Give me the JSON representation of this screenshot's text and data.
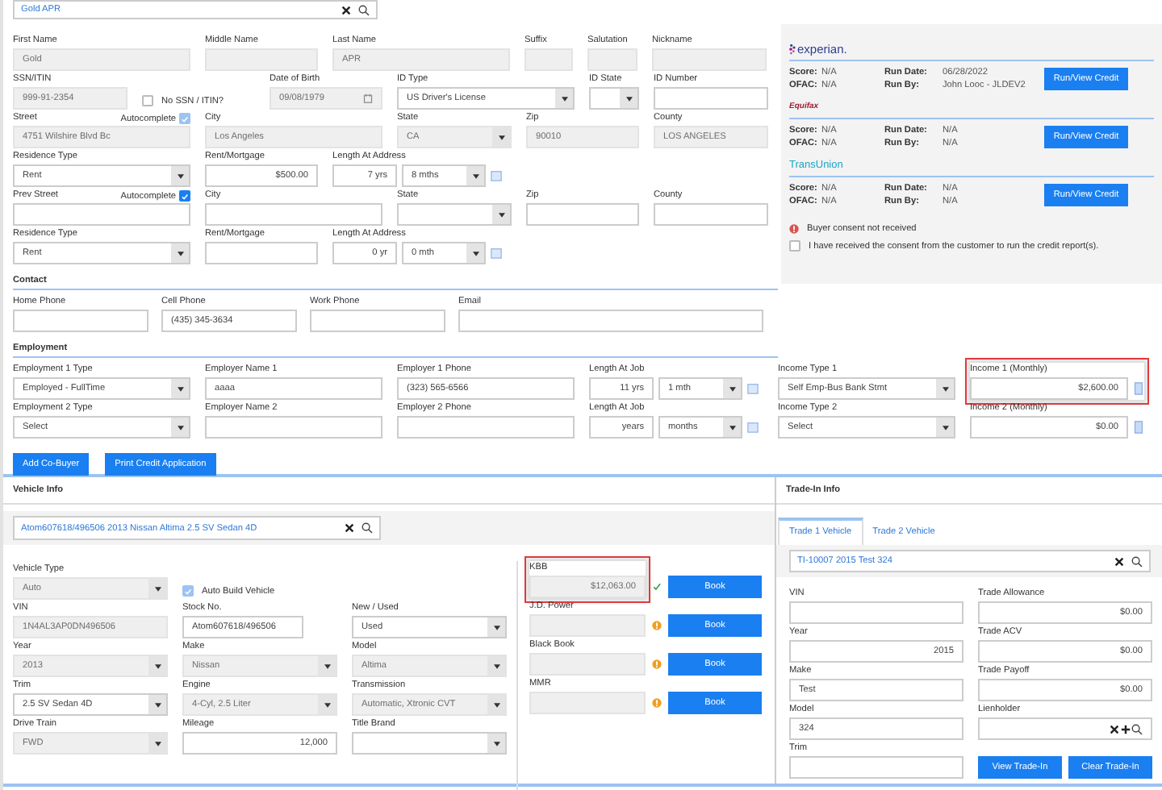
{
  "applicant_search": {
    "value": "Gold APR"
  },
  "applicant_rows": [
    [
      {
        "label": "First Name",
        "kind": "text",
        "value": "Gold",
        "disabled": true
      },
      {
        "label": "Middle Name",
        "kind": "text",
        "disabled": true
      },
      {
        "label": "Last Name",
        "kind": "text",
        "value": "APR",
        "disabled": true
      },
      {
        "label": "Suffix",
        "kind": "text",
        "disabled": true
      },
      {
        "label": "Salutation",
        "kind": "text",
        "disabled": true
      },
      {
        "label": "Nickname",
        "kind": "text",
        "disabled": true
      }
    ],
    [
      {
        "label": "SSN/ITIN",
        "kind": "text",
        "value": "999-91-2354",
        "disabled": true
      },
      {
        "label": "No SSN / ITIN?",
        "kind": "check",
        "checked": false
      },
      {
        "label": "Date of Birth",
        "kind": "date",
        "value": "09/08/1979",
        "disabled": true
      },
      {
        "label": "ID Type",
        "kind": "select",
        "value": "US Driver's License"
      },
      {
        "label": "ID State",
        "kind": "select"
      },
      {
        "label": "ID Number",
        "kind": "text"
      }
    ],
    [
      {
        "label": "Street",
        "kind": "text",
        "value": "4751 Wilshire Blvd Bc",
        "disabled": true,
        "autocomplete": {
          "label": "Autocomplete",
          "checked": true,
          "disabled": true
        }
      },
      {
        "label": "City",
        "kind": "text",
        "value": "Los Angeles",
        "disabled": true
      },
      {
        "label": "State",
        "kind": "select",
        "value": "CA",
        "disabled": true
      },
      {
        "label": "Zip",
        "kind": "text",
        "value": "90010",
        "disabled": true
      },
      {
        "label": "County",
        "kind": "text",
        "value": "LOS ANGELES",
        "disabled": true
      }
    ],
    [
      {
        "label": "Residence Type",
        "kind": "select",
        "value": "Rent"
      },
      {
        "label": "Rent/Mortgage",
        "kind": "number",
        "value": "$500.00"
      },
      {
        "label": "Length At Address",
        "kind": "length",
        "years": "7 yrs",
        "months": "8 mths"
      }
    ],
    [
      {
        "label": "Prev Street",
        "kind": "text",
        "autocomplete": {
          "label": "Autocomplete",
          "checked": true,
          "disabled": false
        }
      },
      {
        "label": "City",
        "kind": "text"
      },
      {
        "label": "State",
        "kind": "select"
      },
      {
        "label": "Zip",
        "kind": "text"
      },
      {
        "label": "County",
        "kind": "text"
      }
    ],
    [
      {
        "label": "Residence Type",
        "kind": "select",
        "value": "Rent"
      },
      {
        "label": "Rent/Mortgage",
        "kind": "number"
      },
      {
        "label": "Length At Address",
        "kind": "length",
        "years": "0 yr",
        "months": "0 mth"
      }
    ]
  ],
  "contact": {
    "title": "Contact",
    "fields": [
      {
        "label": "Home Phone",
        "kind": "text"
      },
      {
        "label": "Cell Phone",
        "kind": "text",
        "value": "(435) 345-3634"
      },
      {
        "label": "Work Phone",
        "kind": "text"
      },
      {
        "label": "Email",
        "kind": "text"
      }
    ]
  },
  "employment": {
    "title": "Employment",
    "rows": [
      [
        {
          "label": "Employment 1 Type",
          "kind": "select",
          "value": "Employed - FullTime"
        },
        {
          "label": "Employer Name 1",
          "kind": "text",
          "value": "aaaa"
        },
        {
          "label": "Employer 1 Phone",
          "kind": "text",
          "value": "(323) 565-6566"
        },
        {
          "label": "Length At Job",
          "kind": "length",
          "years": "11 yrs",
          "months": "1 mth"
        },
        {
          "label": "Income Type 1",
          "kind": "select",
          "value": "Self Emp-Bus Bank Stmt"
        },
        {
          "label": "Income 1 (Monthly)",
          "kind": "income",
          "value": "$2,600.00",
          "highlighted": true
        }
      ],
      [
        {
          "label": "Employment 2 Type",
          "kind": "select",
          "value": "Select"
        },
        {
          "label": "Employer Name 2",
          "kind": "text"
        },
        {
          "label": "Employer 2 Phone",
          "kind": "text"
        },
        {
          "label": "Length At Job",
          "kind": "length",
          "years": "years",
          "months": "months"
        },
        {
          "label": "Income Type 2",
          "kind": "select",
          "value": "Select"
        },
        {
          "label": "Income 2 (Monthly)",
          "kind": "income",
          "value": "$0.00"
        }
      ]
    ],
    "buttons": [
      "Add Co-Buyer",
      "Print Credit Application"
    ]
  },
  "credit": {
    "bureaus": [
      {
        "name": "experian.",
        "kind": "experian",
        "fields": [
          {
            "label": "Score:",
            "value": "N/A"
          },
          {
            "label": "Run Date:",
            "value": "06/28/2022"
          },
          {
            "label": "OFAC:",
            "value": "N/A"
          },
          {
            "label": "Run By:",
            "value": "John Looc - JLDEV2"
          }
        ],
        "button": "Run/View Credit"
      },
      {
        "name": "Equifax",
        "kind": "equifax",
        "fields": [
          {
            "label": "Score:",
            "value": "N/A"
          },
          {
            "label": "Run Date:",
            "value": "N/A"
          },
          {
            "label": "OFAC:",
            "value": "N/A"
          },
          {
            "label": "Run By:",
            "value": "N/A"
          }
        ],
        "button": "Run/View Credit"
      },
      {
        "name": "TransUnion",
        "kind": "transunion",
        "fields": [
          {
            "label": "Score:",
            "value": "N/A"
          },
          {
            "label": "Run Date:",
            "value": "N/A"
          },
          {
            "label": "OFAC:",
            "value": "N/A"
          },
          {
            "label": "Run By:",
            "value": "N/A"
          }
        ],
        "button": "Run/View Credit"
      }
    ],
    "warning": "Buyer consent not received",
    "consent": {
      "label": "I have received the consent from the customer to run the credit report(s).",
      "checked": false
    }
  },
  "vehicle_info": {
    "title": "Vehicle Info",
    "search": {
      "value": "Atom607618/496506 2013 Nissan Altima 2.5 SV Sedan 4D"
    },
    "rows": [
      [
        {
          "label": "Vehicle Type",
          "kind": "select",
          "value": "Auto",
          "disabled": true
        },
        {
          "label": "Auto Build Vehicle",
          "kind": "check",
          "checked": true,
          "disabled": true
        }
      ],
      [
        {
          "label": "VIN",
          "kind": "text",
          "value": "1N4AL3AP0DN496506",
          "disabled": true
        },
        {
          "label": "Stock No.",
          "kind": "text",
          "value": "Atom607618/496506"
        },
        {
          "label": "New / Used",
          "kind": "select",
          "value": "Used"
        }
      ],
      [
        {
          "label": "Year",
          "kind": "select",
          "value": "2013",
          "disabled": true
        },
        {
          "label": "Make",
          "kind": "select",
          "value": "Nissan",
          "disabled": true
        },
        {
          "label": "Model",
          "kind": "select",
          "value": "Altima",
          "disabled": true
        }
      ],
      [
        {
          "label": "Trim",
          "kind": "select",
          "value": "2.5 SV Sedan 4D"
        },
        {
          "label": "Engine",
          "kind": "select",
          "value": "4-Cyl, 2.5 Liter",
          "disabled": true
        },
        {
          "label": "Transmission",
          "kind": "select",
          "value": "Automatic, Xtronic CVT",
          "disabled": true
        }
      ],
      [
        {
          "label": "Drive Train",
          "kind": "select",
          "value": "FWD",
          "disabled": true
        },
        {
          "label": "Mileage",
          "kind": "number",
          "value": "12,000"
        },
        {
          "label": "Title Brand",
          "kind": "select"
        }
      ]
    ],
    "book_values": [
      {
        "label": "KBB",
        "value": "$12,063.00",
        "complete": true,
        "highlighted": true,
        "button": "Book"
      },
      {
        "label": "J.D. Power",
        "complete": false,
        "button": "Book"
      },
      {
        "label": "Black Book",
        "complete": false,
        "button": "Book"
      },
      {
        "label": "MMR",
        "complete": false,
        "button": "Book"
      }
    ]
  },
  "trade_in": {
    "title": "Trade-In Info",
    "tabs": [
      {
        "label": "Trade 1 Vehicle",
        "selected": true
      },
      {
        "label": "Trade 2 Vehicle",
        "selected": false
      }
    ],
    "search": {
      "value": "TI-10007 2015 Test 324"
    },
    "left": [
      {
        "label": "VIN",
        "kind": "text"
      },
      {
        "label": "Year",
        "kind": "number",
        "value": "2015"
      },
      {
        "label": "Make",
        "kind": "text",
        "value": "Test"
      },
      {
        "label": "Model",
        "kind": "text",
        "value": "324"
      },
      {
        "label": "Trim",
        "kind": "text"
      }
    ],
    "right": [
      {
        "label": "Trade Allowance",
        "kind": "number",
        "value": "$0.00"
      },
      {
        "label": "Trade ACV",
        "kind": "number",
        "value": "$0.00"
      },
      {
        "label": "Trade Payoff",
        "kind": "number",
        "value": "$0.00"
      },
      {
        "label": "Lienholder",
        "kind": "lookup"
      }
    ],
    "buttons": [
      "View Trade-In",
      "Clear Trade-In"
    ]
  }
}
